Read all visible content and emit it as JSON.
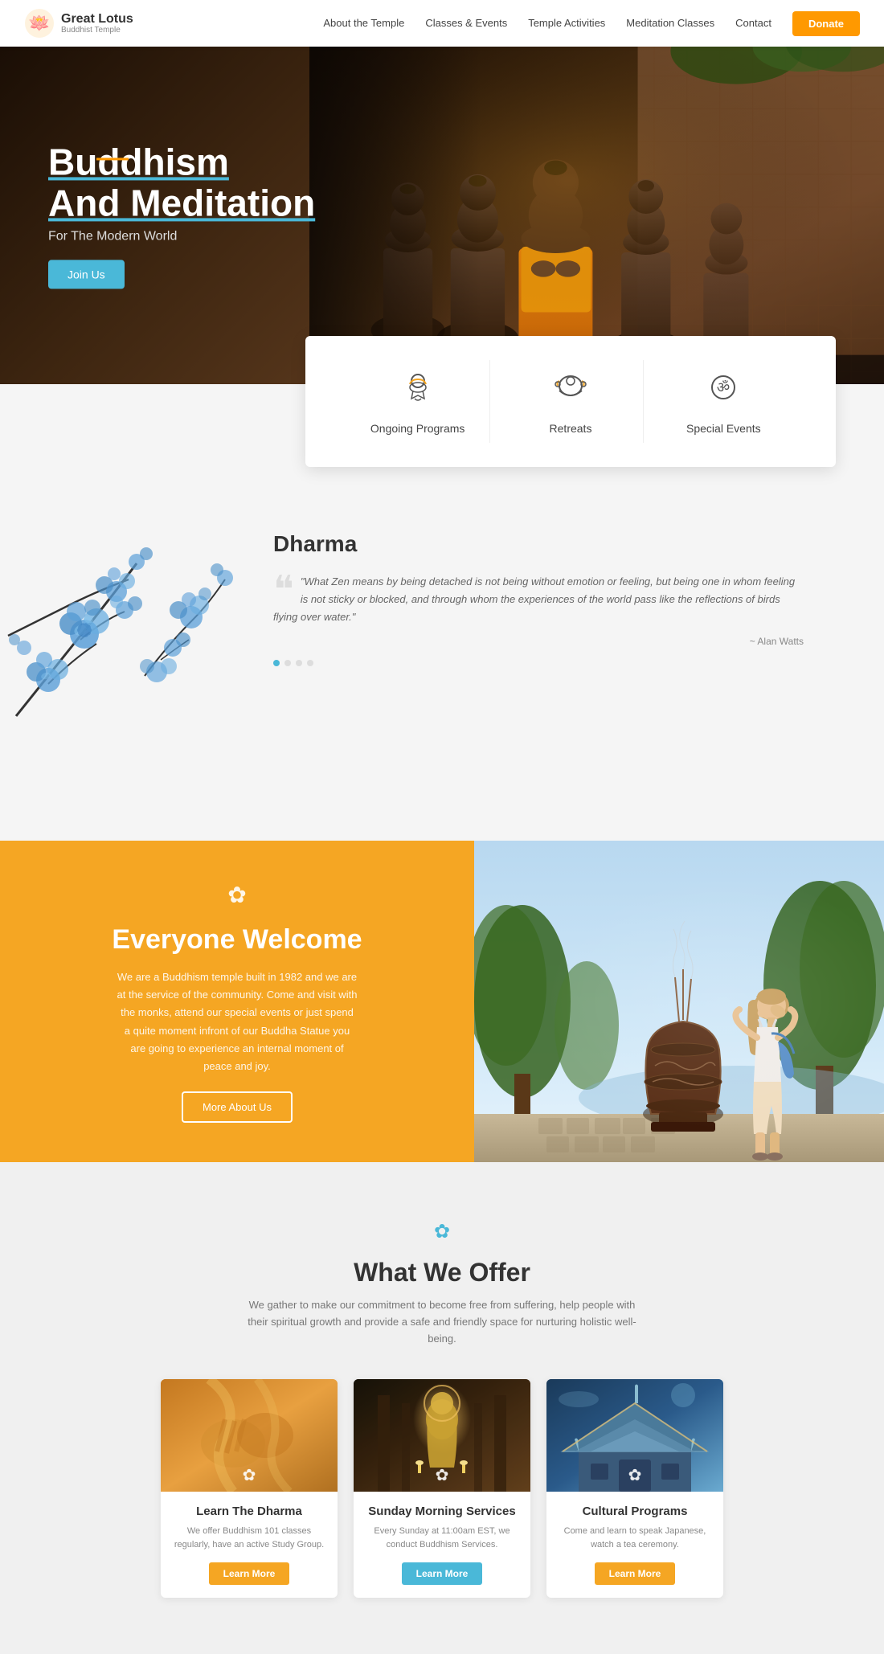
{
  "site": {
    "name": "Great Lotus",
    "tagline": "Buddhist Temple",
    "logo_symbol": "🪷"
  },
  "navbar": {
    "links": [
      {
        "label": "About the Temple",
        "href": "#"
      },
      {
        "label": "Classes & Events",
        "href": "#"
      },
      {
        "label": "Temple Activities",
        "href": "#"
      },
      {
        "label": "Meditation Classes",
        "href": "#"
      },
      {
        "label": "Contact",
        "href": "#"
      }
    ],
    "donate_label": "Donate"
  },
  "hero": {
    "line1": "Buddhism",
    "line2": "And Meditation",
    "subtitle": "For The Modern World",
    "cta": "Join Us"
  },
  "features": {
    "items": [
      {
        "label": "Ongoing Programs",
        "icon": "ongoing"
      },
      {
        "label": "Retreats",
        "icon": "retreats"
      },
      {
        "label": "Special Events",
        "icon": "events"
      }
    ]
  },
  "dharma": {
    "title": "Dharma",
    "quote": "\"What Zen means by being detached is not being without emotion or feeling, but being one in whom feeling is not sticky or blocked, and through whom the experiences of the world pass like the reflections of birds flying over water.\"",
    "author": "~ Alan Watts",
    "dots": [
      true,
      false,
      false,
      false
    ]
  },
  "welcome": {
    "icon": "✿",
    "title": "Everyone Welcome",
    "description": "We are a Buddhism temple built in 1982 and we are at the service of the community. Come and visit with the monks, attend our special events or just spend a quite moment infront of our Buddha Statue you are going to experience an internal moment of peace and joy.",
    "cta": "More About Us"
  },
  "offer": {
    "lotus_icon": "✿",
    "title": "What We Offer",
    "subtitle": "We gather to make our commitment to become free from suffering, help people with their spiritual growth and provide a safe and friendly space for nurturing holistic well-being.",
    "cards": [
      {
        "title": "Learn The Dharma",
        "description": "We offer Buddhism 101 classes regularly, have an active Study Group.",
        "cta": "Learn More",
        "cta_style": "orange"
      },
      {
        "title": "Sunday Morning Services",
        "description": "Every Sunday at 11:00am EST, we conduct Buddhism Services.",
        "cta": "Learn More",
        "cta_style": "blue"
      },
      {
        "title": "Cultural Programs",
        "description": "Come and learn to speak Japanese, watch a tea ceremony.",
        "cta": "Learn More",
        "cta_style": "orange"
      }
    ]
  }
}
